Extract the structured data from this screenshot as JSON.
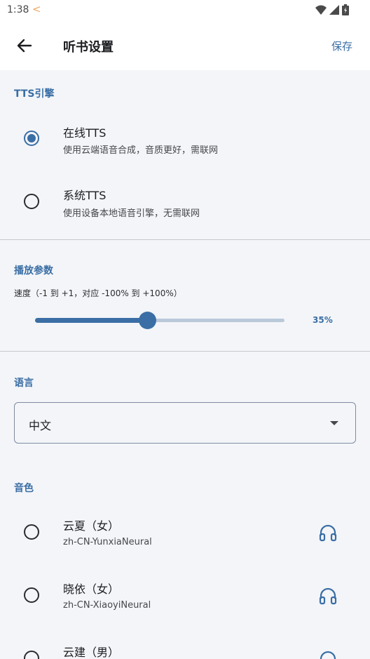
{
  "status_bar": {
    "time": "1:38",
    "back_glyph": "<"
  },
  "app_bar": {
    "title": "听书设置",
    "save_label": "保存"
  },
  "tts_engine": {
    "section_label": "TTS引擎",
    "options": [
      {
        "title": "在线TTS",
        "subtitle": "使用云端语音合成，音质更好，需联网",
        "selected": true
      },
      {
        "title": "系统TTS",
        "subtitle": "使用设备本地语音引擎，无需联网",
        "selected": false
      }
    ]
  },
  "playback": {
    "section_label": "播放参数",
    "speed_description": "速度（-1 到 +1，对应 -100% 到 +100%）",
    "speed_value_label": "35%",
    "speed_fraction": 0.45
  },
  "language": {
    "section_label": "语言",
    "selected_value": "中文"
  },
  "voice": {
    "section_label": "音色",
    "items": [
      {
        "title": "云夏（女）",
        "subtitle": "zh-CN-YunxiaNeural"
      },
      {
        "title": "晓依（女）",
        "subtitle": "zh-CN-XiaoyiNeural"
      },
      {
        "title": "云建（男）",
        "subtitle": ""
      }
    ]
  },
  "colors": {
    "accent": "#3a6ea5",
    "background": "#f3f5f8",
    "divider": "#c6c8cc"
  }
}
